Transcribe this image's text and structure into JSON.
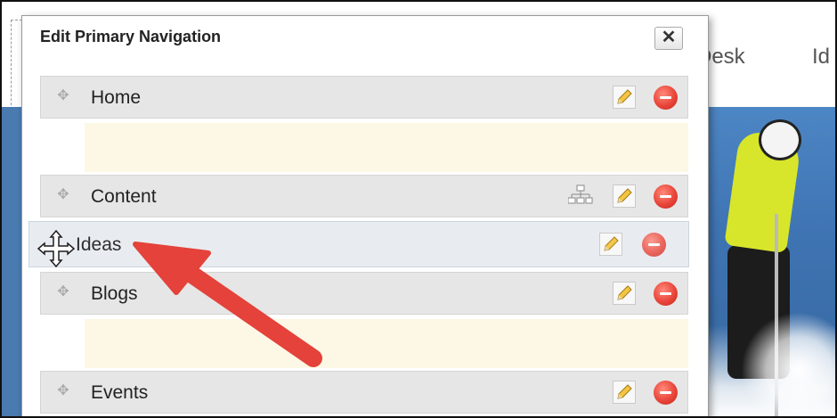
{
  "background": {
    "nav_items": [
      "Desk",
      "Id"
    ]
  },
  "dialog": {
    "title": "Edit Primary Navigation",
    "close_label": "✕",
    "items": [
      {
        "label": "Home"
      },
      {
        "label": "Content"
      },
      {
        "label": "Blogs"
      },
      {
        "label": "Events"
      }
    ],
    "dragged_item": {
      "label": "Ideas"
    }
  },
  "icons": {
    "grip": "move-handle-icon",
    "edit": "pencil-icon",
    "delete": "remove-icon",
    "hierarchy": "sitemap-icon",
    "cursor": "move-cursor-icon",
    "annotation": "red-arrow"
  },
  "colors": {
    "delete_red": "#e9453a",
    "drop_zone": "#fdf7e6",
    "item_bg": "#e6e6e6",
    "arrow_red": "#e4423a"
  }
}
